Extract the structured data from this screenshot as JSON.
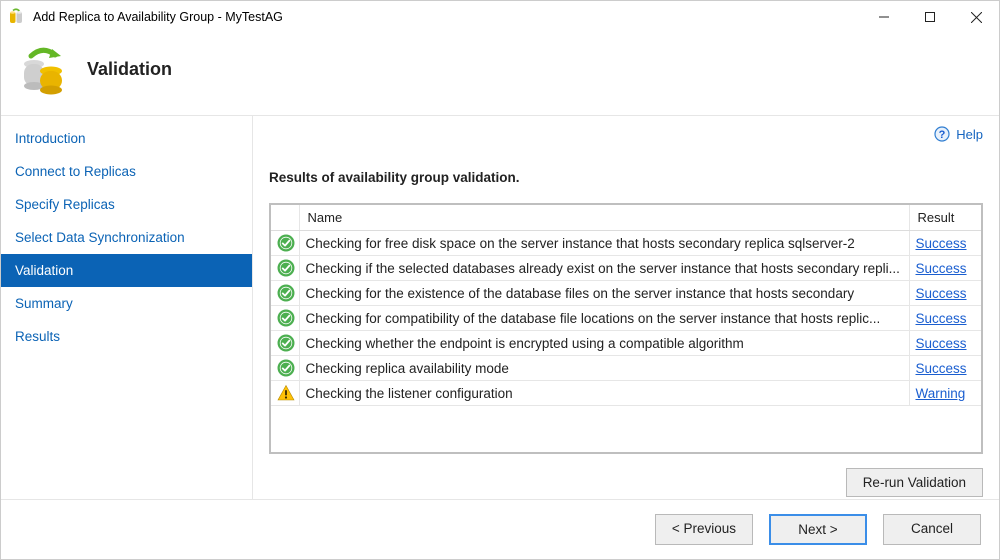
{
  "window": {
    "title": "Add Replica to Availability Group - MyTestAG"
  },
  "header": {
    "heading": "Validation"
  },
  "sidebar": {
    "items": [
      {
        "label": "Introduction"
      },
      {
        "label": "Connect to Replicas"
      },
      {
        "label": "Specify Replicas"
      },
      {
        "label": "Select Data Synchronization"
      },
      {
        "label": "Validation"
      },
      {
        "label": "Summary"
      },
      {
        "label": "Results"
      }
    ],
    "selected_index": 4
  },
  "main": {
    "help_label": "Help",
    "section_title": "Results of availability group validation.",
    "columns": {
      "name": "Name",
      "result": "Result"
    },
    "rows": [
      {
        "status": "success",
        "name": "Checking for free disk space on the server instance that hosts secondary replica sqlserver-2",
        "result": "Success"
      },
      {
        "status": "success",
        "name": "Checking if the selected databases already exist on the server instance that hosts secondary repli...",
        "result": "Success"
      },
      {
        "status": "success",
        "name": "Checking for the existence of the database files on the server instance that hosts secondary",
        "result": "Success"
      },
      {
        "status": "success",
        "name": "Checking for compatibility of the database file locations on the server instance that hosts replic...",
        "result": "Success"
      },
      {
        "status": "success",
        "name": "Checking whether the endpoint is encrypted using a compatible algorithm",
        "result": "Success"
      },
      {
        "status": "success",
        "name": "Checking replica availability mode",
        "result": "Success"
      },
      {
        "status": "warning",
        "name": "Checking the listener configuration",
        "result": "Warning"
      }
    ],
    "rerun_label": "Re-run Validation"
  },
  "footer": {
    "previous": "< Previous",
    "next": "Next >",
    "cancel": "Cancel"
  }
}
